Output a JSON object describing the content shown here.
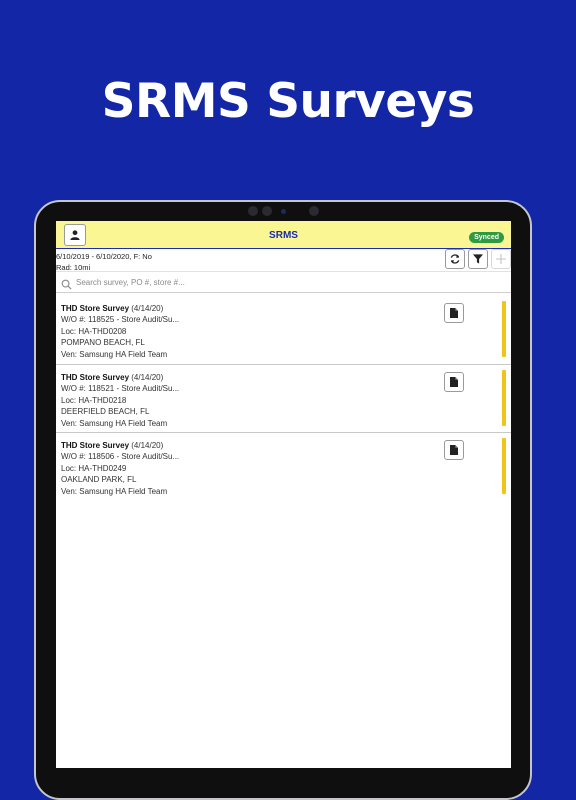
{
  "promo": {
    "title": "SRMS Surveys"
  },
  "header": {
    "title": "SRMS",
    "sync_status": "Synced",
    "profile_icon": "person-icon"
  },
  "filter": {
    "summary_line1": "6/10/2019 - 6/10/2020, F: No",
    "summary_line2": "Rad: 10mi"
  },
  "toolbar": {
    "refresh_icon": "refresh-icon",
    "filter_icon": "filter-icon",
    "add_icon": "plus-icon"
  },
  "search": {
    "placeholder": "Search survey, PO #, store #..."
  },
  "surveys": [
    {
      "title": "THD Store Survey",
      "date": "(4/14/20)",
      "wo": "W/O #: 118525 - Store Audit/Su...",
      "loc": "Loc: HA-THD0208",
      "city": "POMPANO BEACH, FL",
      "vendor": "Ven: Samsung HA Field Team"
    },
    {
      "title": "THD Store Survey",
      "date": "(4/14/20)",
      "wo": "W/O #: 118521 - Store Audit/Su...",
      "loc": "Loc: HA-THD0218",
      "city": "DEERFIELD BEACH, FL",
      "vendor": "Ven: Samsung HA Field Team"
    },
    {
      "title": "THD Store Survey",
      "date": "(4/14/20)",
      "wo": "W/O #: 118506 - Store Audit/Su...",
      "loc": "Loc: HA-THD0249",
      "city": "OAKLAND PARK, FL",
      "vendor": "Ven: Samsung HA Field Team"
    }
  ],
  "colors": {
    "background": "#1226a6",
    "header": "#faf694",
    "accent": "#1b2aa8",
    "synced": "#2f9a3f",
    "status_bar": "#f0c419"
  }
}
